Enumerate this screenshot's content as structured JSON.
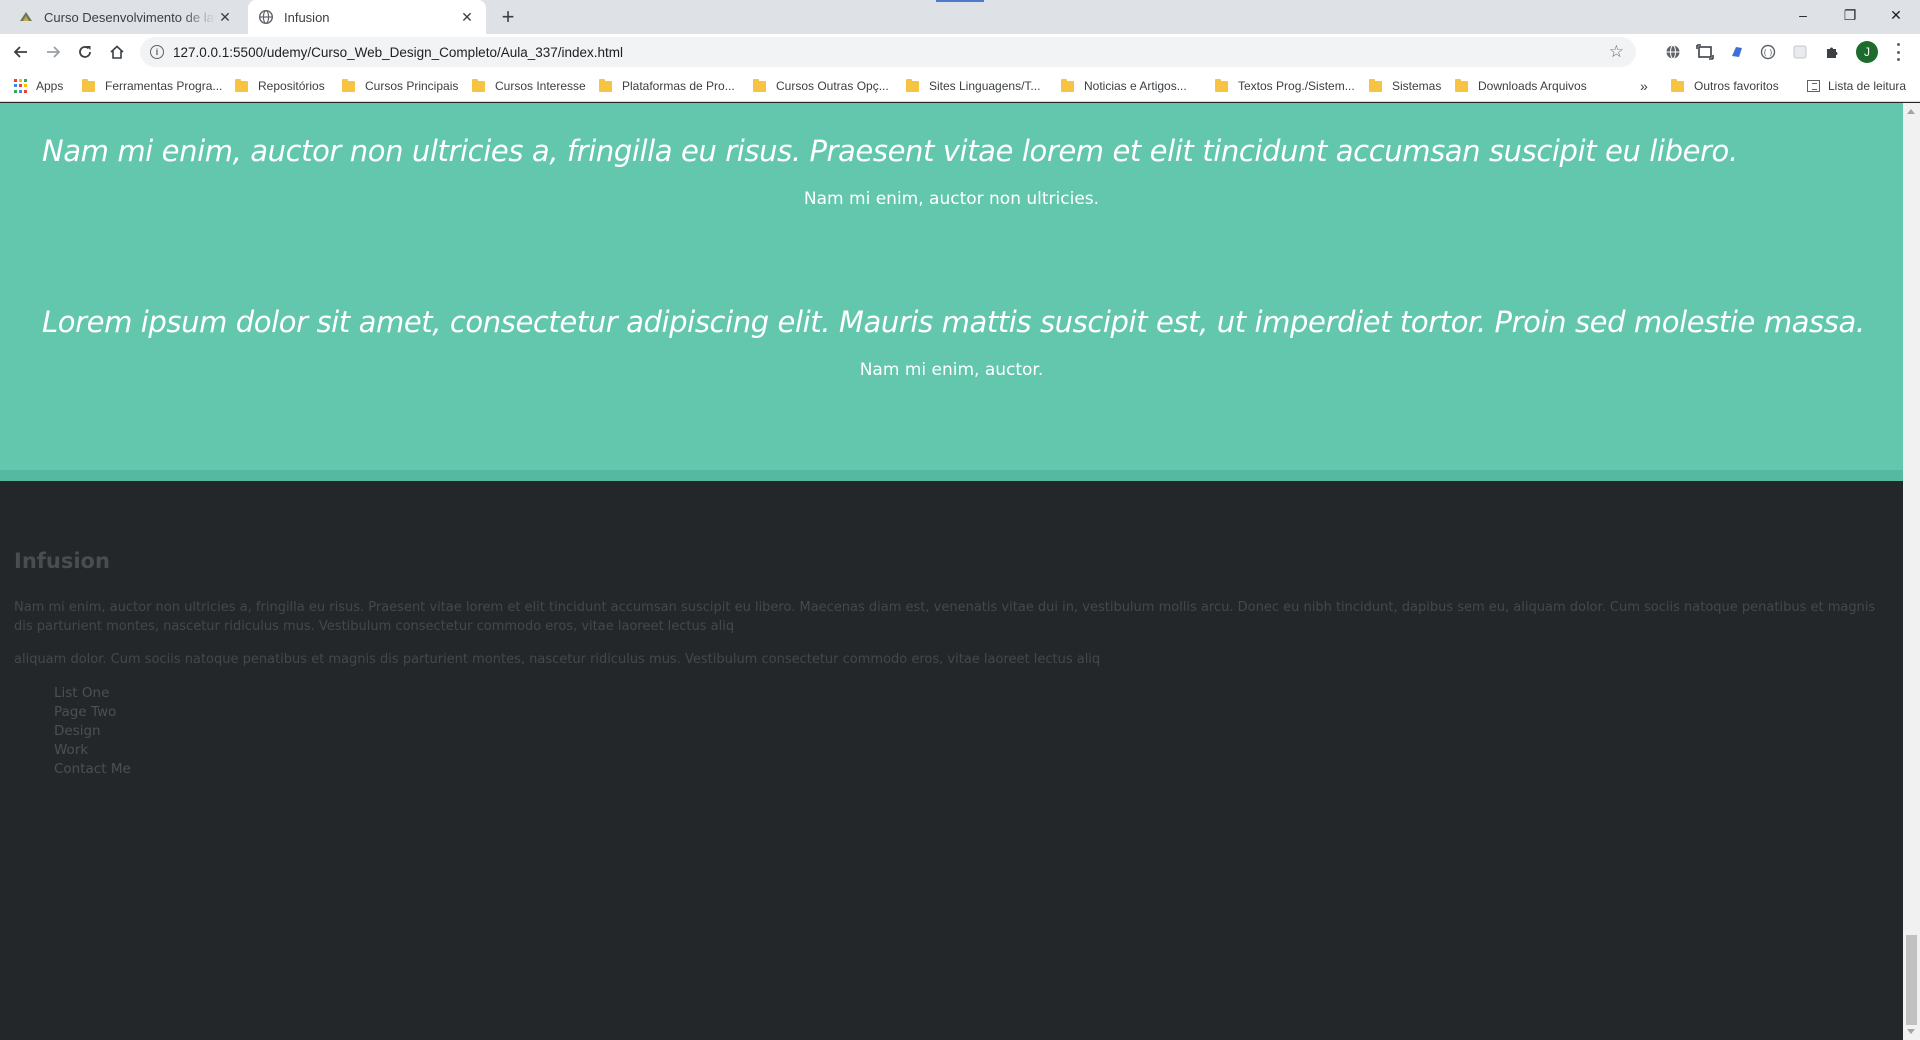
{
  "browser": {
    "tabs": [
      {
        "title": "Curso Desenvolvimento de layout",
        "active": false
      },
      {
        "title": "Infusion",
        "active": true
      }
    ],
    "new_tab_label": "+",
    "window_controls": {
      "minimize": "–",
      "restore": "❐",
      "close": "✕"
    },
    "url": "127.0.0.1:5500/udemy/Curso_Web_Design_Completo/Aula_337/index.html",
    "avatar_letter": "J",
    "bookmarks": {
      "apps_label": "Apps",
      "folders": [
        "Ferramentas Progra...",
        "Repositórios",
        "Cursos Principais",
        "Cursos Interesse",
        "Plataformas de Pro...",
        "Cursos Outras Opç...",
        "Sites Linguagens/T...",
        "Noticias e Artigos...",
        "Textos Prog./Sistem...",
        "Sistemas",
        "Downloads Arquivos"
      ],
      "overflow_label": "»",
      "other_favorites": "Outros favoritos",
      "reading_list": "Lista de leitura"
    }
  },
  "page": {
    "testimonials": [
      {
        "quote": "Nam mi enim, auctor non ultricies a, fringilla eu risus. Praesent vitae lorem et elit tincidunt accumsan suscipit eu libero.",
        "author": "Nam mi enim, auctor non ultricies."
      },
      {
        "quote": "Lorem ipsum dolor sit amet, consectetur adipiscing elit. Mauris mattis suscipit est, ut imperdiet tortor. Proin sed molestie massa.",
        "author": "Nam mi enim, auctor."
      }
    ],
    "footer": {
      "title": "Infusion",
      "paragraph1": "Nam mi enim, auctor non ultricies a, fringilla eu risus. Praesent vitae lorem et elit tincidunt accumsan suscipit eu libero. Maecenas diam est, venenatis vitae dui in, vestibulum mollis arcu. Donec eu nibh tincidunt, dapibus sem eu, aliquam dolor. Cum sociis natoque penatibus et magnis dis parturient montes, nascetur ridiculus mus. Vestibulum consectetur commodo eros, vitae laoreet lectus aliq",
      "paragraph2": "aliquam dolor. Cum sociis natoque penatibus et magnis dis parturient montes, nascetur ridiculus mus. Vestibulum consectetur commodo eros, vitae laoreet lectus aliq",
      "links": [
        "List One",
        "Page Two",
        "Design",
        "Work",
        "Contact Me"
      ]
    }
  },
  "colors": {
    "testimonial_bg": "#63c7ad",
    "footer_bg": "#23272a",
    "footer_text": "#4a5054",
    "chrome_tabbar": "#dee1e6"
  }
}
